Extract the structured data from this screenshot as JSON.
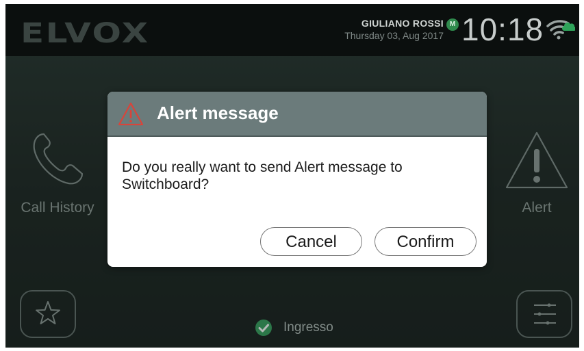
{
  "header": {
    "logo_text": "ELVOX",
    "user_name": "GIULIANO ROSSI",
    "user_badge": "M",
    "date": "Thursday 03, Aug 2017",
    "time": "10:18",
    "wifi_icon": "wifi-cloud-icon",
    "accent_color": "#2f8a4d"
  },
  "left_item": {
    "label": "Call History",
    "icon": "phone-handset-icon"
  },
  "right_item": {
    "label": "Alert",
    "icon": "alert-triangle-icon"
  },
  "bottom": {
    "favorites_icon": "star-icon",
    "settings_icon": "sliders-icon",
    "entrance_label": "Ingresso",
    "entrance_icon": "check-circle-icon"
  },
  "dialog": {
    "title": "Alert message",
    "message": "Do you really want to send Alert message to Switchboard?",
    "cancel_label": "Cancel",
    "confirm_label": "Confirm",
    "header_color": "#6b7b7b",
    "warning_color": "#d9443a"
  }
}
